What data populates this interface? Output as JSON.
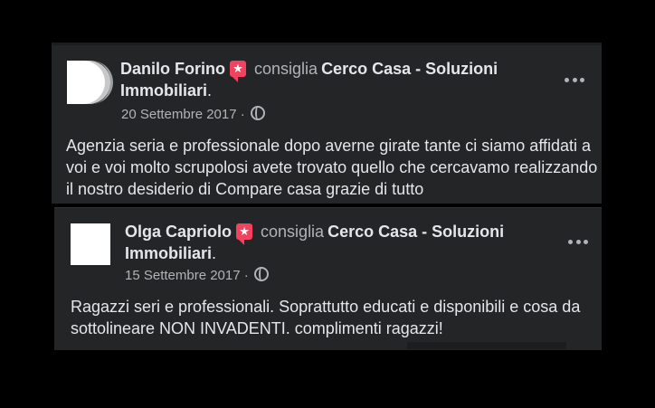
{
  "posts": [
    {
      "author": "Danilo Forino",
      "verb": "consiglia",
      "page": "Cerco Casa - Soluzioni Immobiliari",
      "page_suffix": ".",
      "date": "20 Settembre 2017",
      "separator": "·",
      "privacy_icon": "globe-icon",
      "badge_icon": "recommendation-star-icon",
      "more_icon": "more-options-icon",
      "text": "Agenzia seria e professionale dopo averne girate tante ci siamo affidati a voi e voi molto scrupolosi avete trovato quello che cercavamo realizzando il nostro desiderio di Compare casa grazie di tutto"
    },
    {
      "author": "Olga Capriolo",
      "verb": "consiglia",
      "page": "Cerco Casa - Soluzioni Immobiliari",
      "page_suffix": ".",
      "date": "15 Settembre 2017",
      "separator": "·",
      "privacy_icon": "globe-icon",
      "badge_icon": "recommendation-star-icon",
      "more_icon": "more-options-icon",
      "text": "Ragazzi seri e professionali. Soprattutto educati e disponibili e cosa da sottolineare NON INVADENTI. complimenti ragazzi!"
    }
  ],
  "colors": {
    "background": "#000000",
    "card": "#242526",
    "primary_text": "#e4e6eb",
    "secondary_text": "#b0b3b8",
    "badge": "#f3425f"
  }
}
